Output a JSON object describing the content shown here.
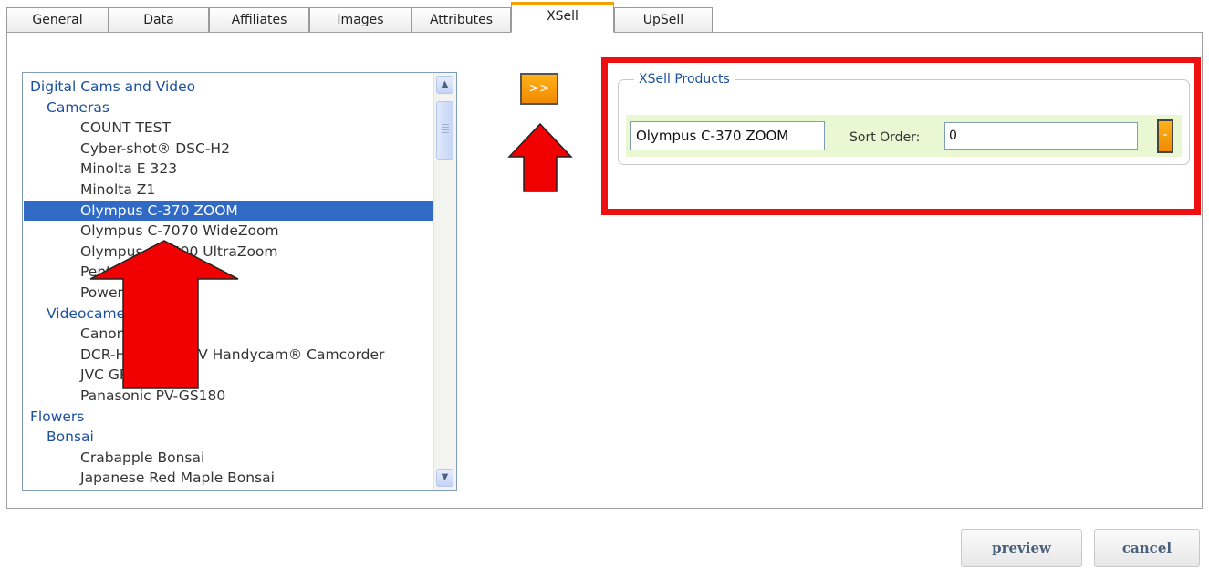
{
  "tabs": [
    {
      "label": "General"
    },
    {
      "label": "Data"
    },
    {
      "label": "Affiliates"
    },
    {
      "label": "Images"
    },
    {
      "label": "Attributes"
    },
    {
      "label": "XSell"
    },
    {
      "label": "UpSell"
    }
  ],
  "active_tab": "XSell",
  "product_list": {
    "items": [
      {
        "label": "Digital Cams and Video",
        "level": 0
      },
      {
        "label": "Cameras",
        "level": 1
      },
      {
        "label": "COUNT TEST",
        "level": 2
      },
      {
        "label": "Cyber-shot® DSC-H2",
        "level": 2
      },
      {
        "label": "Minolta E 323",
        "level": 2
      },
      {
        "label": "Minolta Z1",
        "level": 2
      },
      {
        "label": "Olympus C-370 ZOOM",
        "level": 2,
        "selected": true
      },
      {
        "label": "Olympus C-7070 WideZoom",
        "level": 2
      },
      {
        "label": "Olympus C-8500 UltraZoom",
        "level": 2
      },
      {
        "label": "Pentax Optio 60",
        "level": 2
      },
      {
        "label": "PowerShot A520",
        "level": 2
      },
      {
        "label": "Videocameras",
        "level": 1
      },
      {
        "label": "Canon ZR500",
        "level": 2
      },
      {
        "label": "DCR-HC36 MiniDV Handycam® Camcorder",
        "level": 2
      },
      {
        "label": "JVC GR-D270EK",
        "level": 2
      },
      {
        "label": "Panasonic PV-GS180",
        "level": 2
      },
      {
        "label": "Flowers",
        "level": 0
      },
      {
        "label": "Bonsai",
        "level": 1
      },
      {
        "label": "Crabapple Bonsai",
        "level": 2
      },
      {
        "label": "Japanese Red Maple Bonsai",
        "level": 2
      }
    ],
    "scroll_up_icon": "scroll-up-arrow",
    "scroll_down_icon": "scroll-down-arrow"
  },
  "add_button": {
    "label": ">>"
  },
  "xsell": {
    "legend": "XSell Products",
    "product_value": "Olympus C-370 ZOOM",
    "sort_label": "Sort Order:",
    "sort_value": "0",
    "remove_label": "-"
  },
  "footer": {
    "preview_label": "preview",
    "cancel_label": "cancel"
  },
  "colors": {
    "accent": "#f5a100",
    "selection": "#316ac5",
    "annotation_red": "#ee1010",
    "row_bg": "#e9f7d2",
    "link_blue": "#1b4fa0"
  }
}
